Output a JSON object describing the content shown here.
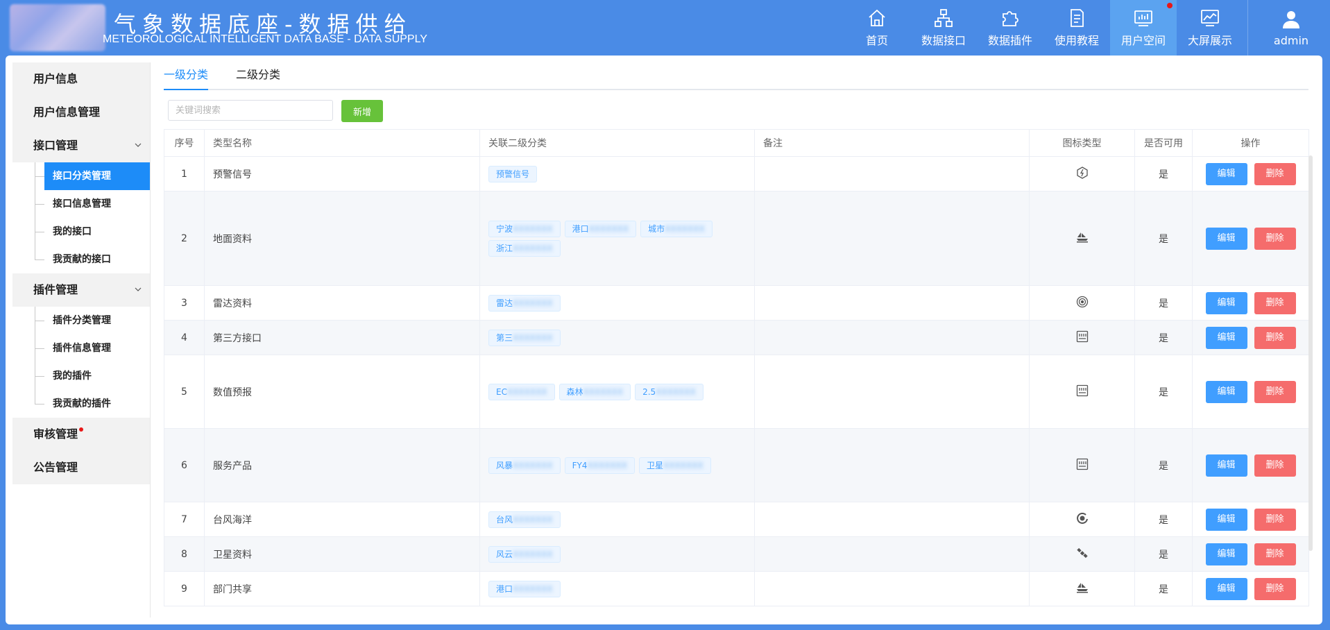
{
  "header": {
    "title_cn": "气象数据底座-数据供给",
    "title_en": "METEOROLOGICAL INTELLIGENT DATA BASE - DATA SUPPLY",
    "nav": [
      {
        "label": "首页",
        "icon": "home-icon"
      },
      {
        "label": "数据接口",
        "icon": "sitemap-icon"
      },
      {
        "label": "数据插件",
        "icon": "puzzle-icon"
      },
      {
        "label": "使用教程",
        "icon": "document-icon"
      },
      {
        "label": "用户空间",
        "icon": "dashboard-icon",
        "active": true,
        "badge": true
      },
      {
        "label": "大屏展示",
        "icon": "chart-screen-icon"
      }
    ],
    "user": "admin"
  },
  "sidebar": {
    "user_info": "用户信息",
    "user_info_mgmt": "用户信息管理",
    "interface_mgmt": "接口管理",
    "interface_items": [
      "接口分类管理",
      "接口信息管理",
      "我的接口",
      "我贡献的接口"
    ],
    "plugin_mgmt": "插件管理",
    "plugin_items": [
      "插件分类管理",
      "插件信息管理",
      "我的插件",
      "我贡献的插件"
    ],
    "review_mgmt": "审核管理",
    "notice_mgmt": "公告管理"
  },
  "tabs": [
    "一级分类",
    "二级分类"
  ],
  "search": {
    "placeholder": "关键词搜索",
    "value": ""
  },
  "add_label": "新增",
  "table": {
    "headers": [
      "序号",
      "类型名称",
      "关联二级分类",
      "备注",
      "图标类型",
      "是否可用",
      "操作"
    ],
    "edit_label": "编辑",
    "delete_label": "删除",
    "rows": [
      {
        "no": "1",
        "name": "预警信号",
        "icon": "warning-signal-icon",
        "enabled": "是",
        "tags": [
          [
            "预警信号"
          ]
        ]
      },
      {
        "no": "2",
        "name": "地面资料",
        "icon": "ship-icon",
        "enabled": "是",
        "tags": [
          [
            "宁波",
            "XXXXXXX"
          ],
          [
            "港口",
            "XXXXXXX"
          ],
          [
            "城市",
            "XXXXXXX"
          ],
          [
            "浙江",
            "XXXXXXX"
          ]
        ]
      },
      {
        "no": "3",
        "name": "雷达资料",
        "icon": "radar-icon",
        "enabled": "是",
        "tags": [
          [
            "雷达",
            "XXXXXXX"
          ]
        ]
      },
      {
        "no": "4",
        "name": "第三方接口",
        "icon": "grid-icon",
        "enabled": "是",
        "tags": [
          [
            "第三",
            "XXXXXXX"
          ]
        ]
      },
      {
        "no": "5",
        "name": "数值预报",
        "icon": "grid-icon",
        "enabled": "是",
        "tags": [
          [
            "EC",
            "XXXXXXX"
          ],
          [
            "森林",
            "XXXXXXX"
          ],
          [
            "2.5",
            "XXXXXXX"
          ]
        ]
      },
      {
        "no": "6",
        "name": "服务产品",
        "icon": "grid-icon",
        "enabled": "是",
        "tags": [
          [
            "风暴",
            "XXXXXXX"
          ],
          [
            "FY4",
            "XXXXXXX"
          ],
          [
            "卫星",
            "XXXXXXX"
          ]
        ]
      },
      {
        "no": "7",
        "name": "台风海洋",
        "icon": "typhoon-icon",
        "enabled": "是",
        "tags": [
          [
            "台风",
            "XXXXXXX"
          ]
        ]
      },
      {
        "no": "8",
        "name": "卫星资料",
        "icon": "satellite-icon",
        "enabled": "是",
        "tags": [
          [
            "风云",
            "XXXXXXX"
          ]
        ]
      },
      {
        "no": "9",
        "name": "部门共享",
        "icon": "ship-icon",
        "enabled": "是",
        "tags": [
          [
            "港口",
            "XXXXXXX"
          ]
        ]
      }
    ]
  }
}
